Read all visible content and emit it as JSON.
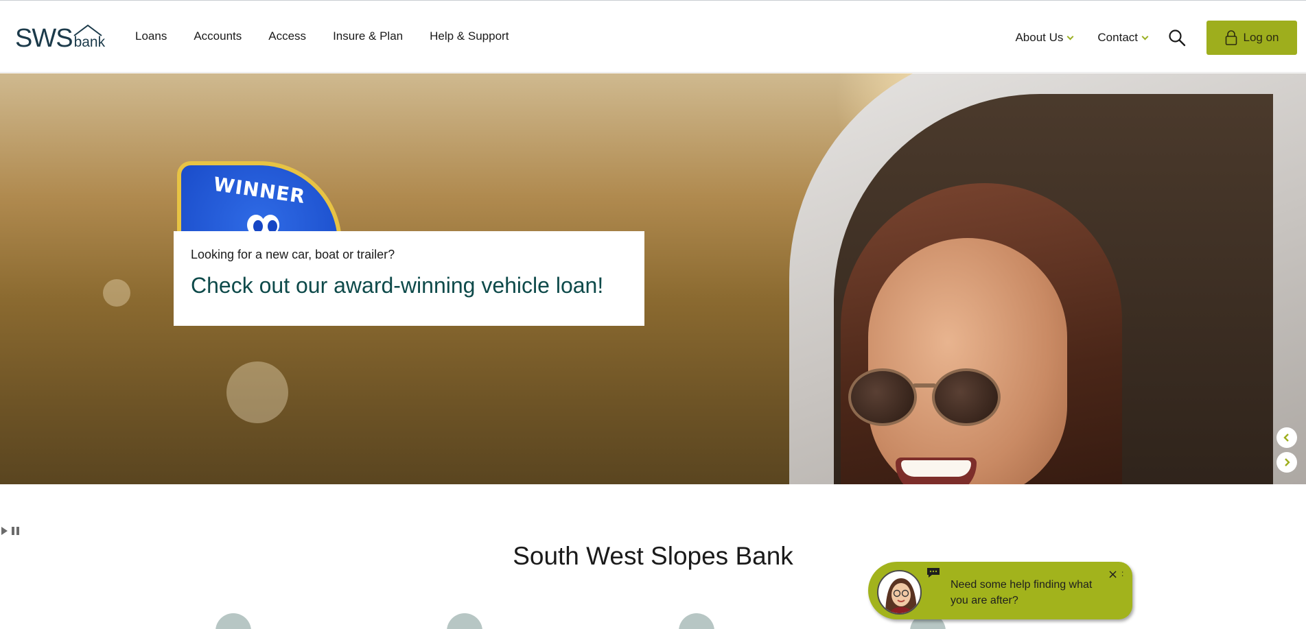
{
  "header": {
    "logo": {
      "main": "SWS",
      "sub": "bank"
    },
    "nav": [
      "Loans",
      "Accounts",
      "Access",
      "Insure & Plan",
      "Help & Support"
    ],
    "right_nav": {
      "about": "About Us",
      "contact": "Contact"
    },
    "search_icon": "search-icon",
    "logon_label": "Log on",
    "accent": "#9eae1d"
  },
  "hero": {
    "badge_text": "WINNER",
    "promo_sub": "Looking for a new car, boat or trailer?",
    "promo_title": "Check out our award-winning vehicle loan!",
    "prev_icon": "chevron-left-icon",
    "next_icon": "chevron-right-icon"
  },
  "carousel": {
    "play_icon": "play-icon",
    "pause_icon": "pause-icon"
  },
  "main": {
    "title": "South West Slopes Bank"
  },
  "chat": {
    "message": "Need some help finding what you are after?",
    "close_label": "×",
    "menu_label": ":",
    "color": "#a2b31c"
  }
}
